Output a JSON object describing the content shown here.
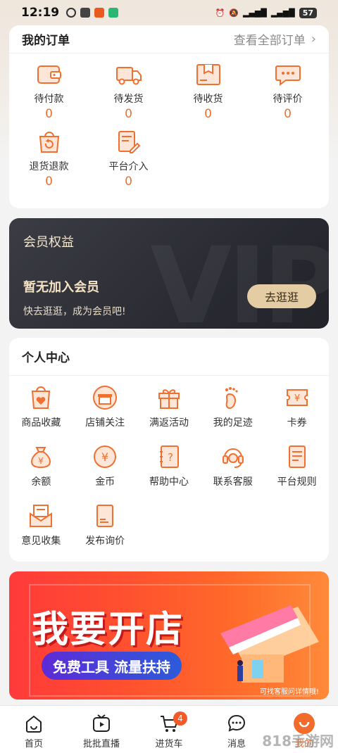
{
  "status": {
    "time": "12:19",
    "battery": "57"
  },
  "orders": {
    "title": "我的订单",
    "view_all": "查看全部订单",
    "items": [
      {
        "label": "待付款",
        "count": "0",
        "icon": "wallet-icon"
      },
      {
        "label": "待发货",
        "count": "0",
        "icon": "truck-icon"
      },
      {
        "label": "待收货",
        "count": "0",
        "icon": "package-icon"
      },
      {
        "label": "待评价",
        "count": "0",
        "icon": "comment-icon"
      },
      {
        "label": "退货退款",
        "count": "0",
        "icon": "refund-bag-icon"
      },
      {
        "label": "平台介入",
        "count": "0",
        "icon": "document-edit-icon"
      }
    ]
  },
  "member": {
    "title": "会员权益",
    "status": "暂无加入会员",
    "desc": "快去逛逛，成为会员吧!",
    "button": "去逛逛",
    "bg_text": "VIP"
  },
  "center": {
    "title": "个人中心",
    "items": [
      {
        "label": "商品收藏",
        "icon": "heart-bag-icon"
      },
      {
        "label": "店铺关注",
        "icon": "store-icon"
      },
      {
        "label": "满返活动",
        "icon": "gift-icon"
      },
      {
        "label": "我的足迹",
        "icon": "footprint-icon"
      },
      {
        "label": "卡券",
        "icon": "coupon-icon"
      },
      {
        "label": "余额",
        "icon": "money-bag-icon"
      },
      {
        "label": "金币",
        "icon": "coin-icon"
      },
      {
        "label": "帮助中心",
        "icon": "help-book-icon"
      },
      {
        "label": "联系客服",
        "icon": "headset-icon"
      },
      {
        "label": "平台规则",
        "icon": "rules-doc-icon"
      },
      {
        "label": "意见收集",
        "icon": "envelope-icon"
      },
      {
        "label": "发布询价",
        "icon": "price-doc-icon"
      }
    ]
  },
  "banner": {
    "title": "我要开店",
    "subtitle": "免费工具 流量扶持",
    "note": "可找客服问详情哦!"
  },
  "tabs": [
    {
      "label": "首页",
      "icon": "home-icon"
    },
    {
      "label": "批批直播",
      "icon": "live-tv-icon"
    },
    {
      "label": "进货车",
      "icon": "cart-icon",
      "badge": "4"
    },
    {
      "label": "消息",
      "icon": "message-icon"
    },
    {
      "label": "我的",
      "icon": "profile-icon",
      "active": true
    }
  ],
  "watermark": "818手游网",
  "colors": {
    "accent": "#f07030",
    "member_gold": "#e4cda5",
    "banner_red": "#ff3a3a"
  }
}
